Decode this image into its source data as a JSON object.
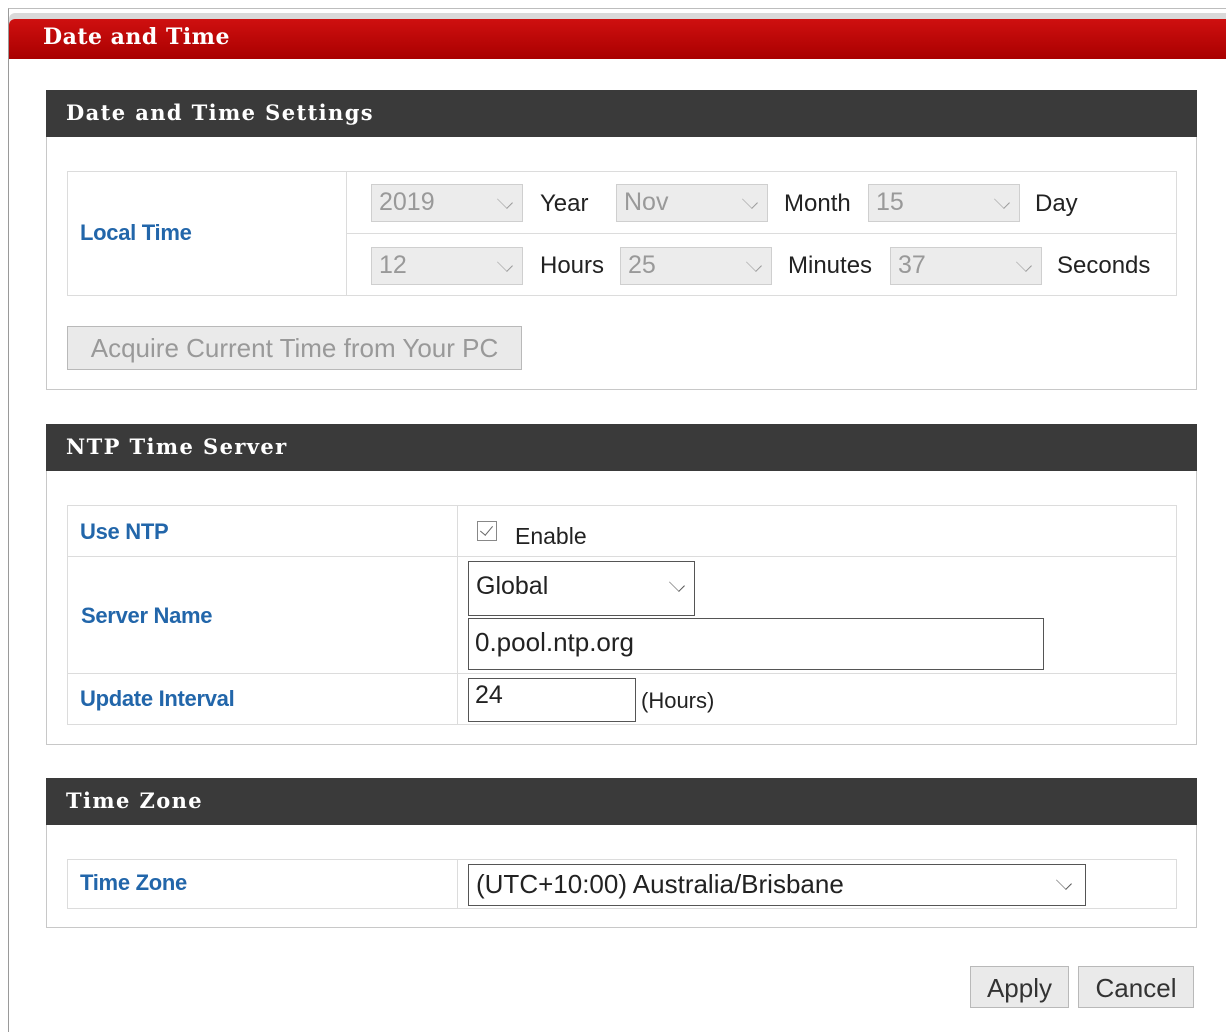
{
  "page": {
    "title": "Date and Time"
  },
  "date_time_settings": {
    "header": "Date and Time Settings",
    "local_time_label": "Local Time",
    "year": {
      "value": "2019",
      "unit": "Year"
    },
    "month": {
      "value": "Nov",
      "unit": "Month"
    },
    "day": {
      "value": "15",
      "unit": "Day"
    },
    "hours": {
      "value": "12",
      "unit": "Hours"
    },
    "minutes": {
      "value": "25",
      "unit": "Minutes"
    },
    "seconds": {
      "value": "37",
      "unit": "Seconds"
    },
    "acquire_button": "Acquire Current Time from Your PC"
  },
  "ntp": {
    "header": "NTP Time Server",
    "use_ntp_label": "Use NTP",
    "enable_label": "Enable",
    "enable_checked": true,
    "server_name_label": "Server Name",
    "server_select_value": "Global",
    "server_value": "0.pool.ntp.org",
    "update_interval_label": "Update Interval",
    "update_interval_value": "24",
    "update_interval_unit": "(Hours)"
  },
  "time_zone": {
    "header": "Time Zone",
    "label": "Time Zone",
    "value": "(UTC+10:00) Australia/Brisbane"
  },
  "actions": {
    "apply": "Apply",
    "cancel": "Cancel"
  },
  "colors": {
    "title_bar": "#b80000",
    "section_header": "#3a3a3a",
    "label_blue": "#2266aa"
  }
}
